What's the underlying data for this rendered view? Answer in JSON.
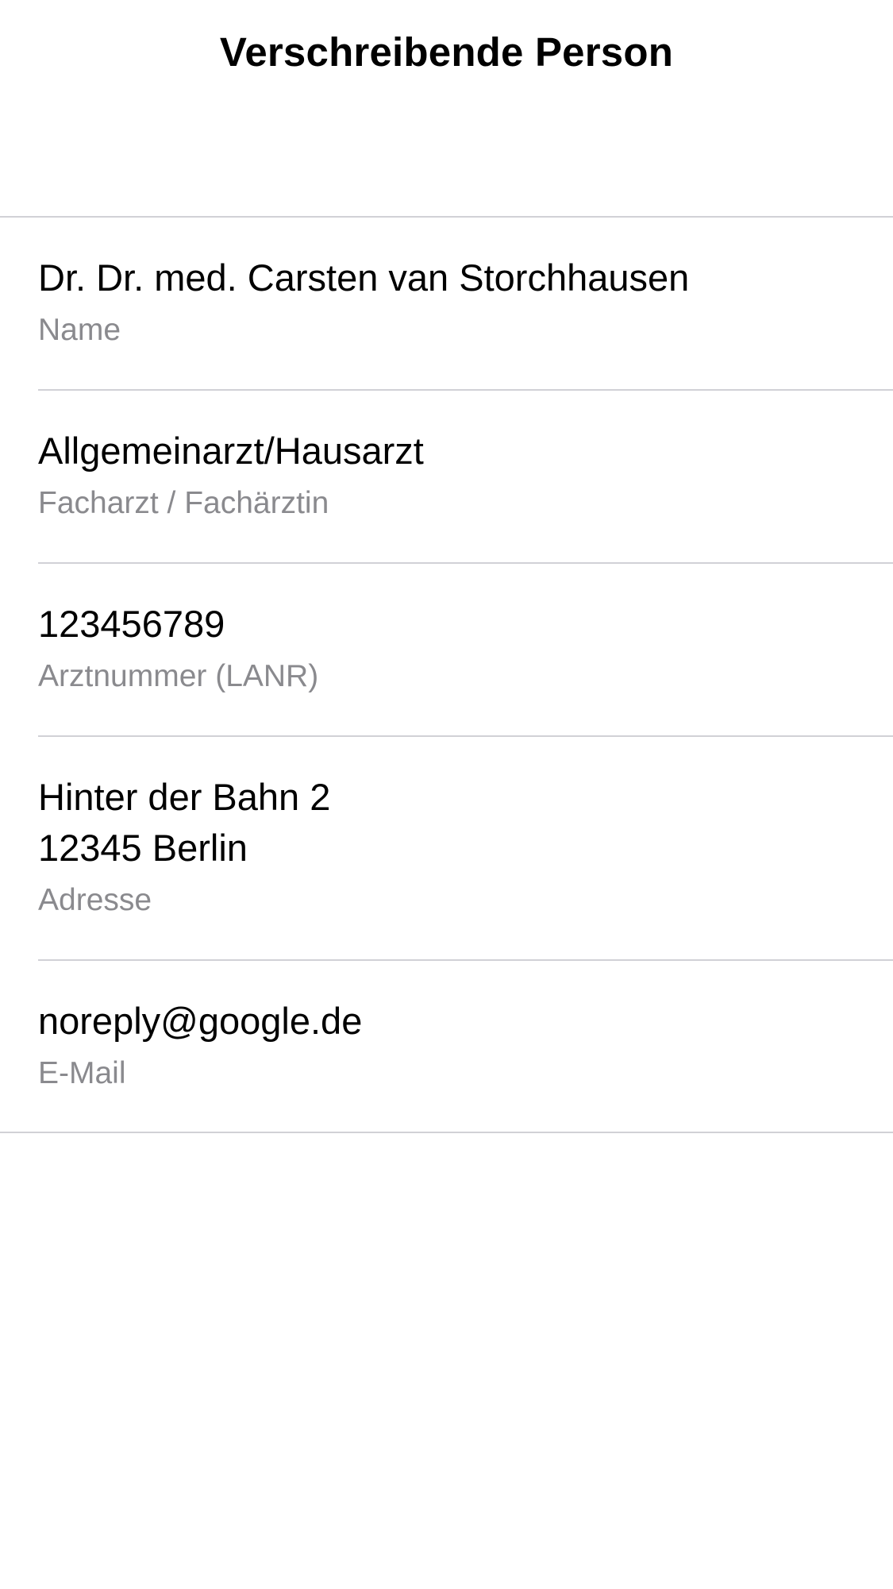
{
  "navigation": {
    "title": "Verschreibende Person"
  },
  "fields": {
    "name": {
      "value": "Dr. Dr. med. Carsten van Storchhausen",
      "label": "Name"
    },
    "specialty": {
      "value": "Allgemeinarzt/Hausarzt",
      "label": "Facharzt / Fachärztin"
    },
    "lanr": {
      "value": "123456789",
      "label": "Arztnummer (LANR)"
    },
    "address": {
      "line1": "Hinter der Bahn 2",
      "line2": "12345 Berlin",
      "label": "Adresse"
    },
    "email": {
      "value": "noreply@google.de",
      "label": "E-Mail"
    }
  }
}
